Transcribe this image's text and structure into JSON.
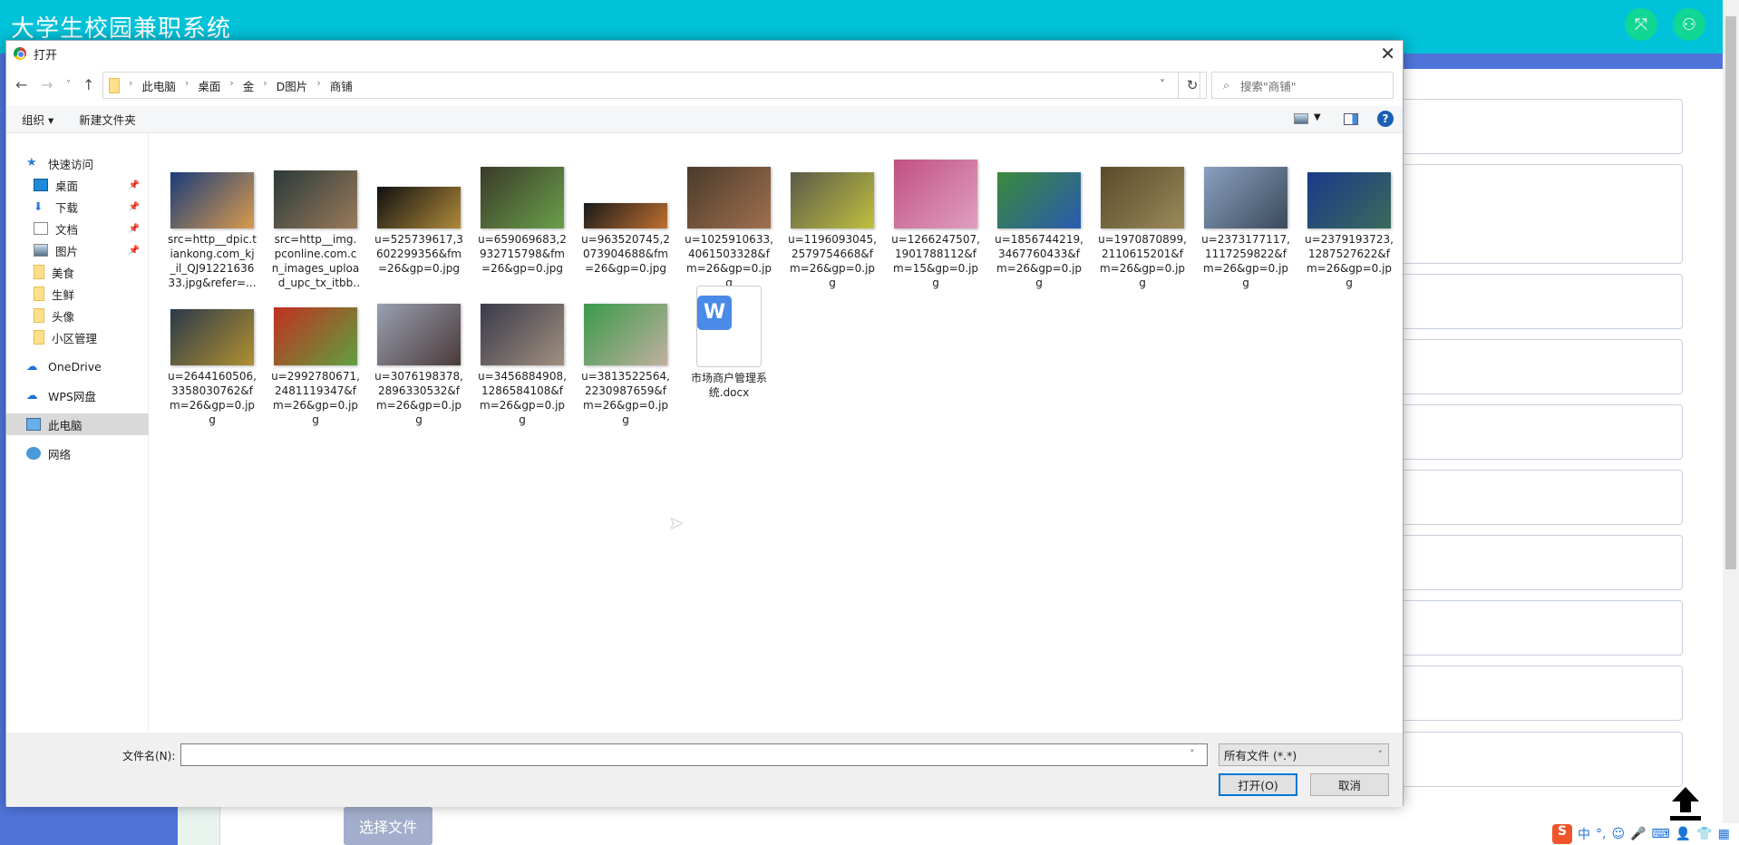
{
  "app": {
    "title": "大学生校园兼职系统",
    "fullscreen_icon": "expand-icon",
    "user_icon": "user-icon",
    "pick_file_label": "选择文件"
  },
  "dialog": {
    "title": "打开",
    "breadcrumb": [
      "此电脑",
      "桌面",
      "金",
      "D图片",
      "商铺"
    ],
    "search_placeholder": "搜索\"商铺\"",
    "toolbar": {
      "organize": "组织 ▾",
      "new_folder": "新建文件夹"
    },
    "nav": [
      {
        "label": "快速访问",
        "icon": "star-icon",
        "pinned": false
      },
      {
        "label": "桌面",
        "icon": "desktop-icon",
        "pinned": true
      },
      {
        "label": "下载",
        "icon": "download-icon",
        "pinned": true
      },
      {
        "label": "文档",
        "icon": "document-icon",
        "pinned": true
      },
      {
        "label": "图片",
        "icon": "pictures-icon",
        "pinned": true
      },
      {
        "label": "美食",
        "icon": "folder-icon",
        "pinned": false
      },
      {
        "label": "生鲜",
        "icon": "folder-icon",
        "pinned": false
      },
      {
        "label": "头像",
        "icon": "folder-icon",
        "pinned": false
      },
      {
        "label": "小区管理",
        "icon": "folder-icon",
        "pinned": false
      },
      {
        "label": "OneDrive",
        "icon": "cloud-icon",
        "pinned": false
      },
      {
        "label": "WPS网盘",
        "icon": "cloud-icon",
        "pinned": false
      },
      {
        "label": "此电脑",
        "icon": "computer-icon",
        "pinned": false,
        "selected": true
      },
      {
        "label": "网络",
        "icon": "network-icon",
        "pinned": false
      }
    ],
    "files": [
      {
        "name": "src=http__dpic.tiankong.com_kj_il_QJ9122163633.jpg&refer=...",
        "colors": [
          "#1b3c7a",
          "#d99a4c"
        ]
      },
      {
        "name": "src=http__img.pconline.com.cn_images_upload_upc_tx_itbbs...",
        "colors": [
          "#2a3a3a",
          "#9a7a5a"
        ]
      },
      {
        "name": "u=525739617,3602299356&fm=26&gp=0.jpg",
        "colors": [
          "#111",
          "#b08a3a"
        ]
      },
      {
        "name": "u=659069683,2932715798&fm=26&gp=0.jpg",
        "colors": [
          "#3a3a2a",
          "#6aa04a"
        ]
      },
      {
        "name": "u=963520745,2073904688&fm=26&gp=0.jpg",
        "colors": [
          "#1a1a1a",
          "#c07030"
        ]
      },
      {
        "name": "u=1025910633,4061503328&fm=26&gp=0.jpg",
        "colors": [
          "#4a3a2a",
          "#a07050"
        ]
      },
      {
        "name": "u=1196093045,2579754668&fm=26&gp=0.jpg",
        "colors": [
          "#5a5a4a",
          "#c0c040"
        ]
      },
      {
        "name": "u=1266247507,1901788112&fm=15&gp=0.jpg",
        "colors": [
          "#c05080",
          "#e0a0c0"
        ]
      },
      {
        "name": "u=1856744219,3467760433&fm=26&gp=0.jpg",
        "colors": [
          "#3a8a3a",
          "#2a5ab0"
        ]
      },
      {
        "name": "u=1970870899,2110615201&fm=26&gp=0.jpg",
        "colors": [
          "#5a4a2a",
          "#9a8a5a"
        ]
      },
      {
        "name": "u=2373177117,1117259822&fm=26&gp=0.jpg",
        "colors": [
          "#8aa0c0",
          "#3a4a5a"
        ]
      },
      {
        "name": "u=2379193723,1287527622&fm=26&gp=0.jpg",
        "colors": [
          "#1a3a8a",
          "#3a6a5a"
        ]
      },
      {
        "name": "u=2644160506,3358030762&fm=26&gp=0.jpg",
        "colors": [
          "#2a3a4a",
          "#b09030"
        ]
      },
      {
        "name": "u=2992780671,2481119347&fm=26&gp=0.jpg",
        "colors": [
          "#c03020",
          "#60a040"
        ]
      },
      {
        "name": "u=3076198378,2896330532&fm=26&gp=0.jpg",
        "colors": [
          "#9aa0b0",
          "#4a3a3a"
        ]
      },
      {
        "name": "u=3456884908,1286584108&fm=26&gp=0.jpg",
        "colors": [
          "#3a3a4a",
          "#a09080"
        ]
      },
      {
        "name": "u=3813522564,2230987659&fm=26&gp=0.jpg",
        "colors": [
          "#3a9a4a",
          "#c0b0a0"
        ]
      },
      {
        "name": "市场商户管理系统.docx",
        "type": "docx"
      }
    ],
    "filename_label": "文件名(N):",
    "filename_value": "",
    "filter": "所有文件 (*.*)",
    "open_label": "打开(O)",
    "cancel_label": "取消"
  },
  "ime": {
    "logo": "S",
    "items": [
      "中",
      "°,",
      "☺",
      "🎤",
      "⌨",
      "👤",
      "👕",
      "▦"
    ]
  }
}
